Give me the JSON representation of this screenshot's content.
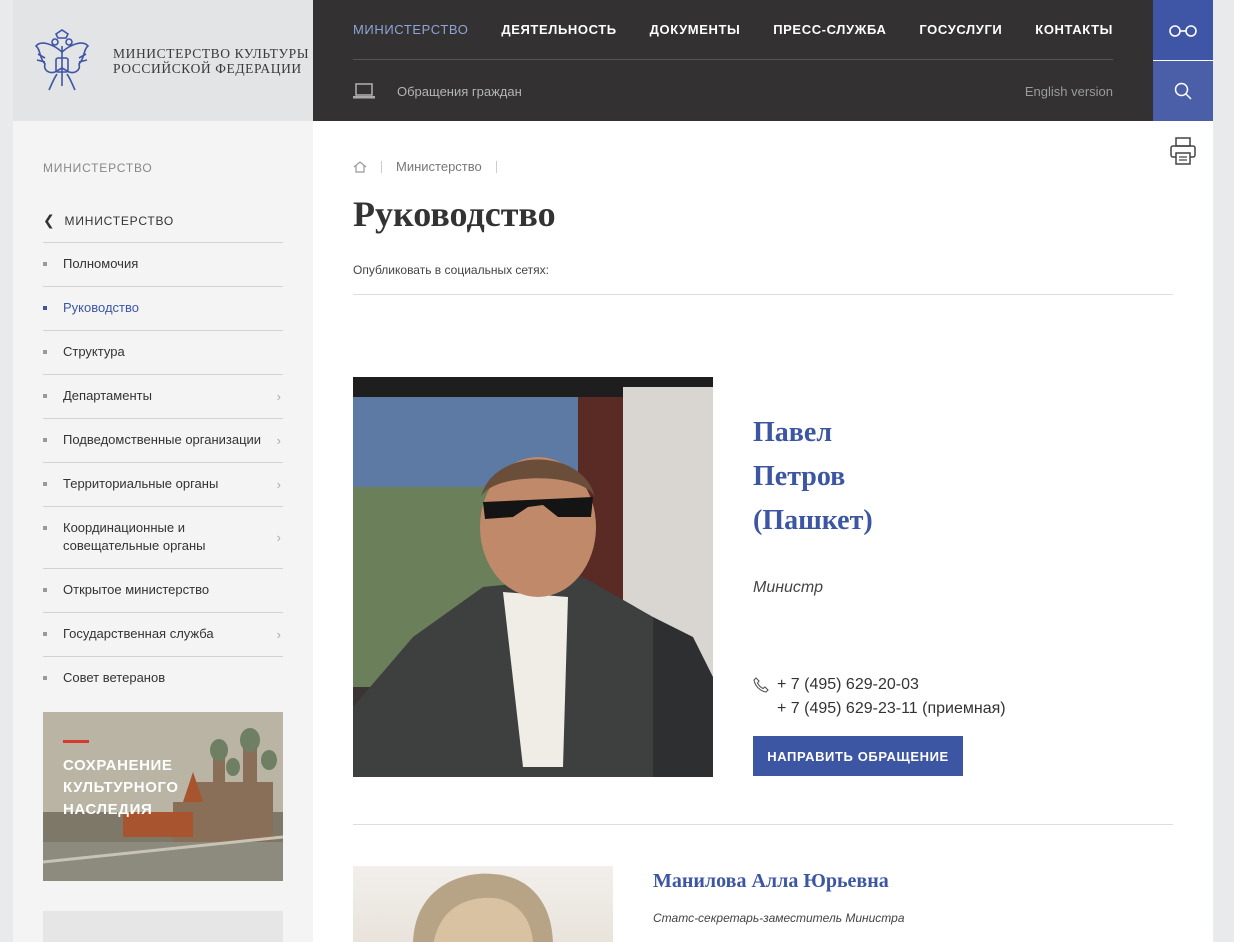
{
  "header": {
    "logo_line1": "Министерство культуры",
    "logo_line2": "Российской Федерации",
    "nav": [
      "Министерство",
      "Деятельность",
      "Документы",
      "Пресс-служба",
      "Госуслуги",
      "Контакты"
    ],
    "appeals_label": "Обращения граждан",
    "english_label": "English version"
  },
  "sidebar": {
    "heading": "Министерство",
    "back_label": "Министерство",
    "items": [
      {
        "label": "Полномочия"
      },
      {
        "label": "Руководство"
      },
      {
        "label": "Структура"
      },
      {
        "label": "Департаменты"
      },
      {
        "label": "Подведомственные организации"
      },
      {
        "label": "Территориальные органы"
      },
      {
        "label": "Координационные и совещательные органы"
      },
      {
        "label": "Открытое министерство"
      },
      {
        "label": "Государственная служба"
      },
      {
        "label": "Совет ветеранов"
      }
    ],
    "banner_line1": "Сохранение",
    "banner_line2": "культурного",
    "banner_line3": "наследия"
  },
  "main": {
    "breadcrumb_item": "Министерство",
    "title": "Руководство",
    "share_label": "Опубликовать в социальных сетях:",
    "person1": {
      "name_line1": "Павел",
      "name_line2": "Петров",
      "name_line3": "(Пашкет)",
      "role": "Министр",
      "phone1": "+ 7 (495) 629-20-03",
      "phone2": "+ 7 (495) 629-23-11 (приемная)",
      "button": "Направить обращение"
    },
    "person2": {
      "name": "Манилова Алла Юрьевна",
      "role": "Статс-секретарь-заместитель Министра"
    }
  },
  "colors": {
    "accent": "#3c56a3",
    "header_dark": "#333132",
    "sidebar_bg": "#f4f4f5"
  }
}
